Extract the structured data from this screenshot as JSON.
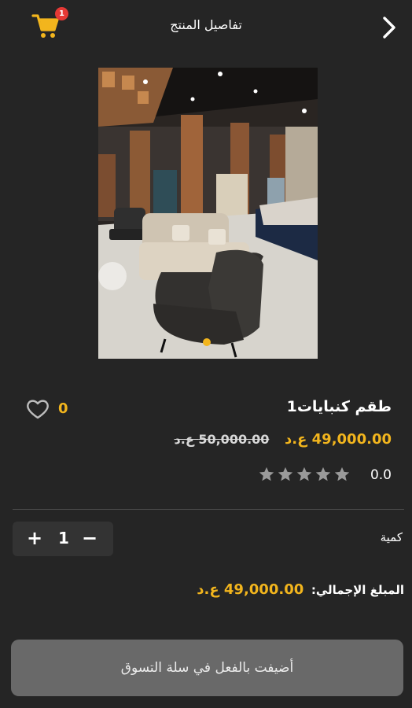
{
  "header": {
    "title": "تفاصيل المنتج",
    "cart_count": "1",
    "cart_icon": "cart-icon",
    "back_icon": "chevron-right-icon"
  },
  "product": {
    "name": "طقم كنبايات1",
    "likes": "0",
    "price": "49,000.00 ع.د",
    "old_price": "50,000.00 ع.د",
    "rating": "0.0",
    "stars": 0,
    "stars_total": 5,
    "image_index": 0
  },
  "quantity": {
    "label": "كمية",
    "value": "1",
    "plus": "+",
    "minus": "−"
  },
  "total": {
    "label": "المبلغ الإجمالي:",
    "value": "49,000.00 ع.د"
  },
  "add_button": {
    "label": "أضيفت بالفعل في سلة التسوق"
  },
  "colors": {
    "accent": "#f2b51d",
    "background": "#252525",
    "button": "#696969",
    "badge": "#e53935",
    "star_inactive": "#9a9a9a"
  }
}
